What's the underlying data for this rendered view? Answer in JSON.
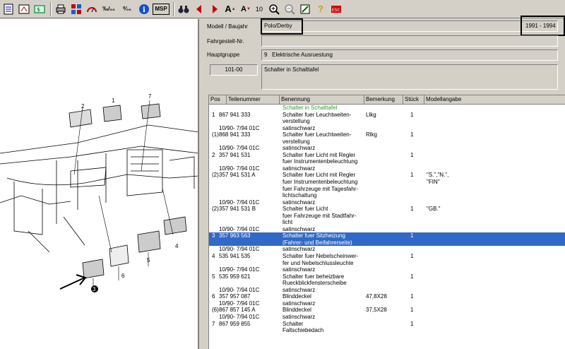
{
  "toolbar": {
    "buttons": [
      {
        "name": "list-view-icon"
      },
      {
        "name": "parts-catalog-icon"
      },
      {
        "name": "currency-icon"
      },
      {
        "name": "print-icon"
      },
      {
        "name": "tiles-icon"
      },
      {
        "name": "gauge-icon"
      },
      {
        "name": "permille-icon",
        "text": "‰/‰"
      },
      {
        "name": "percent-icon",
        "text": "%/00"
      },
      {
        "name": "info-icon"
      },
      {
        "name": "msp-icon",
        "text": "MSP"
      },
      {
        "name": "binoculars-icon"
      },
      {
        "name": "prev-arrow-icon"
      },
      {
        "name": "next-arrow-icon"
      },
      {
        "name": "font-larger-icon"
      },
      {
        "name": "font-smaller-icon"
      },
      {
        "name": "zoom-in-icon"
      },
      {
        "name": "zoom-out-icon"
      },
      {
        "name": "edit-icon"
      },
      {
        "name": "help-icon"
      },
      {
        "name": "exit-icon"
      }
    ],
    "font_size": "10"
  },
  "form": {
    "model_label": "Modell / Baujahr",
    "model_value": "Polo/Derby",
    "year_value": "1991 - 1994",
    "chassis_label": "Fahrgestell-Nr.",
    "chassis_value": "",
    "group_label": "Hauptgruppe",
    "group_num": "9",
    "group_value": "Elektrische Ausruestung",
    "subgroup_num": "101-00",
    "subgroup_value": "Schalter in Schalttafel"
  },
  "grid": {
    "headers": [
      "Pos",
      "Teilenummer",
      "Benennung",
      "Bemerkung",
      "Stück",
      "Modellangabe"
    ],
    "rows": [
      {
        "pos": "",
        "part": "",
        "name": "Schalter in Schalttafel",
        "note": "",
        "qty": "",
        "model": "",
        "green": true
      },
      {
        "pos": "1",
        "part": "867 941 333",
        "name": "Schalter fuer Leuchtweiten-",
        "note": "Llkg",
        "qty": "1",
        "model": ""
      },
      {
        "pos": "",
        "part": "",
        "name": "verstellung",
        "note": "",
        "qty": "",
        "model": ""
      },
      {
        "pos": "",
        "part": "10/90- 7/94 01C",
        "name": "satinschwarz",
        "note": "",
        "qty": "",
        "model": ""
      },
      {
        "pos": "(1)",
        "part": "868 941 333",
        "name": "Schalter fuer Leuchtweiten-",
        "note": "Rlkg",
        "qty": "1",
        "model": ""
      },
      {
        "pos": "",
        "part": "",
        "name": "verstellung",
        "note": "",
        "qty": "",
        "model": ""
      },
      {
        "pos": "",
        "part": "10/90- 7/94 01C",
        "name": "satinschwarz",
        "note": "",
        "qty": "",
        "model": ""
      },
      {
        "pos": "2",
        "part": "357 941 531",
        "name": "Schalter fuer Licht mit Regler",
        "note": "",
        "qty": "1",
        "model": ""
      },
      {
        "pos": "",
        "part": "",
        "name": "fuer Instrumentenbeleuchtung",
        "note": "",
        "qty": "",
        "model": ""
      },
      {
        "pos": "",
        "part": "10/90- 7/94 01C",
        "name": "satinschwarz",
        "note": "",
        "qty": "",
        "model": ""
      },
      {
        "pos": "(2)",
        "part": "357 941 531 A",
        "name": "Schalter fuer Licht mit Regler",
        "note": "",
        "qty": "1",
        "model": "\"S.\",\"N.\","
      },
      {
        "pos": "",
        "part": "",
        "name": "fuer Instrumentenbeleuchtung",
        "note": "",
        "qty": "",
        "model": "\"FIN\""
      },
      {
        "pos": "",
        "part": "",
        "name": "fuer Fahrzeuge mit Tagesfahr-",
        "note": "",
        "qty": "",
        "model": ""
      },
      {
        "pos": "",
        "part": "",
        "name": "lichtschaltung",
        "note": "",
        "qty": "",
        "model": ""
      },
      {
        "pos": "",
        "part": "10/90- 7/94 01C",
        "name": "satinschwarz",
        "note": "",
        "qty": "",
        "model": ""
      },
      {
        "pos": "(2)",
        "part": "357 941 531 B",
        "name": "Schalter fuer Licht",
        "note": "",
        "qty": "1",
        "model": "\"GB.\""
      },
      {
        "pos": "",
        "part": "",
        "name": "fuer Fahrzeuge mit Stadtfahr-",
        "note": "",
        "qty": "",
        "model": ""
      },
      {
        "pos": "",
        "part": "",
        "name": "licht",
        "note": "",
        "qty": "",
        "model": ""
      },
      {
        "pos": "",
        "part": "10/90- 7/94 01C",
        "name": "satinschwarz",
        "note": "",
        "qty": "",
        "model": ""
      },
      {
        "pos": "3",
        "part": "357 963 563",
        "name": "Schalter fuer Sitzheizung",
        "note": "",
        "qty": "1",
        "model": "",
        "selected": true
      },
      {
        "pos": "",
        "part": "",
        "name": "(Fahrer- und Beifahrerseite)",
        "note": "",
        "qty": "",
        "model": "",
        "selected": true
      },
      {
        "pos": "",
        "part": "10/90- 7/94 01C",
        "name": "satinschwarz",
        "note": "",
        "qty": "",
        "model": ""
      },
      {
        "pos": "4",
        "part": "535 941 535",
        "name": "Schalter fuer Nebelscheinwer-",
        "note": "",
        "qty": "1",
        "model": ""
      },
      {
        "pos": "",
        "part": "",
        "name": "fer und Nebelschlussleuchte",
        "note": "",
        "qty": "",
        "model": ""
      },
      {
        "pos": "",
        "part": "10/90- 7/94 01C",
        "name": "satinschwarz",
        "note": "",
        "qty": "",
        "model": ""
      },
      {
        "pos": "5",
        "part": "535 959 621",
        "name": "Schalter fuer beheizbare",
        "note": "",
        "qty": "1",
        "model": ""
      },
      {
        "pos": "",
        "part": "",
        "name": "Rueckblickfensterscheibe",
        "note": "",
        "qty": "",
        "model": ""
      },
      {
        "pos": "",
        "part": "10/90- 7/94 01C",
        "name": "satinschwarz",
        "note": "",
        "qty": "",
        "model": ""
      },
      {
        "pos": "6",
        "part": "357 957 087",
        "name": "Blinddeckel",
        "note": "47,8X28",
        "qty": "1",
        "model": ""
      },
      {
        "pos": "",
        "part": "10/90- 7/94 01C",
        "name": "satinschwarz",
        "note": "",
        "qty": "",
        "model": ""
      },
      {
        "pos": "(6)",
        "part": "867 857 145 A",
        "name": "Blinddeckel",
        "note": "37,5X28",
        "qty": "1",
        "model": ""
      },
      {
        "pos": "",
        "part": "10/90- 7/94 01C",
        "name": "satinschwarz",
        "note": "",
        "qty": "",
        "model": ""
      },
      {
        "pos": "7",
        "part": "867 959 855",
        "name": "Schalter",
        "note": "",
        "qty": "1",
        "model": ""
      },
      {
        "pos": "",
        "part": "",
        "name": "Faltschiebedach",
        "note": "",
        "qty": "",
        "model": ""
      }
    ]
  },
  "diagram": {
    "labels": [
      "2",
      "1",
      "7",
      "4",
      "5",
      "6",
      "3"
    ]
  },
  "colors": {
    "selected": "#3169c6",
    "green_text": "#2e9a2e",
    "panel": "#d4d0c8"
  }
}
